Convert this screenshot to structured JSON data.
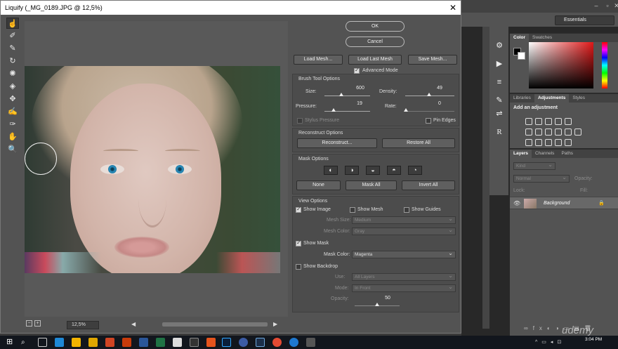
{
  "liquify": {
    "title": "Liquify (_MG_0189.JPG @ 12,5%)",
    "ok_label": "OK",
    "cancel_label": "Cancel",
    "load_mesh": "Load Mesh...",
    "load_last_mesh": "Load Last Mesh",
    "save_mesh": "Save Mesh...",
    "advanced_mode": "Advanced Mode",
    "brush_tool_options": {
      "heading": "Brush Tool Options",
      "size_label": "Size:",
      "size_value": "600",
      "density_label": "Density:",
      "density_value": "49",
      "pressure_label": "Pressure:",
      "pressure_value": "19",
      "rate_label": "Rate:",
      "rate_value": "0",
      "stylus_pressure": "Stylus Pressure",
      "pin_edges": "Pin Edges"
    },
    "reconstruct_options": {
      "heading": "Reconstruct Options",
      "reconstruct": "Reconstruct...",
      "restore_all": "Restore All"
    },
    "mask_options": {
      "heading": "Mask Options",
      "none": "None",
      "mask_all": "Mask All",
      "invert_all": "Invert All"
    },
    "view_options": {
      "heading": "View Options",
      "show_image": "Show Image",
      "show_mesh": "Show Mesh",
      "show_guides": "Show Guides",
      "mesh_size_label": "Mesh Size:",
      "mesh_size_value": "Medium",
      "mesh_color_label": "Mesh Color:",
      "mesh_color_value": "Gray",
      "show_mask": "Show Mask",
      "mask_color_label": "Mask Color:",
      "mask_color_value": "Magenta",
      "show_backdrop": "Show Backdrop",
      "use_label": "Use:",
      "use_value": "All Layers",
      "mode_label": "Mode:",
      "mode_value": "In Front",
      "opacity_label": "Opacity:",
      "opacity_value": "50"
    },
    "zoom": "12,5%"
  },
  "photoshop": {
    "workspace": "Essentials",
    "color_tab": "Color",
    "swatches_tab": "Swatches",
    "libraries_tab": "Libraries",
    "adjustments_tab": "Adjustments",
    "styles_tab": "Styles",
    "add_adjustment": "Add an adjustment",
    "layers_tab": "Layers",
    "channels_tab": "Channels",
    "paths_tab": "Paths",
    "kind": "Kind",
    "blend_mode": "Normal",
    "opacity_label": "Opacity:",
    "fill_label": "Fill:",
    "lock_label": "Lock:",
    "layer_name": "Background"
  },
  "taskbar": {
    "time": "3:04 PM",
    "brand": "udemy"
  }
}
